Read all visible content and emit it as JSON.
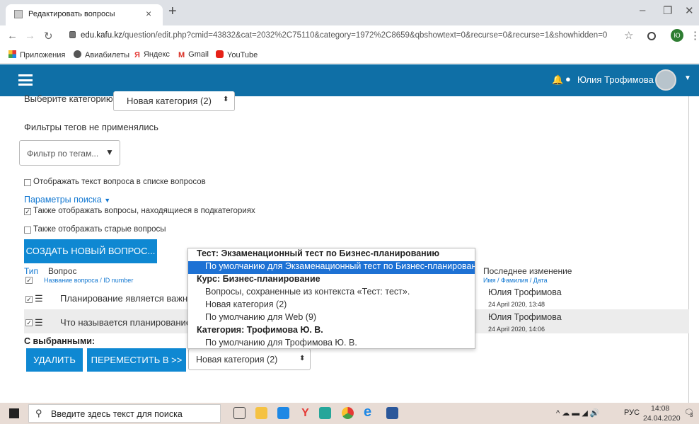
{
  "browser": {
    "tab_title": "Редактировать вопросы",
    "tab_close": "×",
    "new_tab": "+",
    "url_host": "edu.kafu.kz",
    "url_path": "/question/edit.php?cmid=43832&cat=2032%2C75110&category=1972%2C8659&qbshowtext=0&recurse=0&recurse=1&showhidden=0",
    "profile_initials": "Ю",
    "bookmarks": [
      "Приложения",
      "Авиабилеты",
      "Яндекс",
      "Gmail",
      "YouTube"
    ]
  },
  "header": {
    "user_name": "Юлия Трофимова"
  },
  "filters": {
    "category_label": "Выберите категорию:",
    "category_value": "Новая категория (2)",
    "tags_note": "Фильтры тегов не применялись",
    "tag_filter_placeholder": "Фильтр по тегам...",
    "show_question_text": "Отображать текст вопроса в списке вопросов",
    "search_params": "Параметры поиска",
    "include_subcategories": "Также отображать вопросы, находящиеся в подкатегориях",
    "show_old": "Также отображать старые вопросы"
  },
  "actions": {
    "create_question": "СОЗДАТЬ НОВЫЙ ВОПРОС...",
    "with_selected": "С выбранными:",
    "delete": "УДАЛИТЬ",
    "move_to": "ПЕРЕМЕСТИТЬ В >>",
    "move_target": "Новая категория (2)"
  },
  "table": {
    "col_type": "Тип",
    "col_question": "Вопрос",
    "sort_links": "Название вопроса / ID number",
    "col_modified": "Последнее изменение",
    "modified_sort": "Имя / Фамилия / Дата",
    "rows": [
      {
        "name": "Планирование является важнейш",
        "author": "Юлия Трофимова",
        "date": "24 April 2020, 13:48"
      },
      {
        "name": "Что называется планированием?",
        "author": "Юлия Трофимова",
        "date": "24 April 2020, 14:06"
      }
    ]
  },
  "dropdown": {
    "items": [
      {
        "text": "Тест: Экзаменационный тест по Бизнес-планированию",
        "kind": "group"
      },
      {
        "text": "По умолчанию для Экзаменационный тест по Бизнес-планированию",
        "kind": "selected"
      },
      {
        "text": "Курс: Бизнес-планирование",
        "kind": "group"
      },
      {
        "text": "Вопросы, сохраненные из контекста «Тест: тест».",
        "kind": "option"
      },
      {
        "text": "Новая категория (2)",
        "kind": "option"
      },
      {
        "text": "По умолчанию для Web (9)",
        "kind": "option"
      },
      {
        "text": "Категория: Трофимова Ю. В.",
        "kind": "group"
      },
      {
        "text": "По умолчанию для Трофимова Ю. В.",
        "kind": "option"
      }
    ]
  },
  "taskbar": {
    "search_placeholder": "Введите здесь текст для поиска",
    "lang": "РУС",
    "time": "14:08",
    "date": "24.04.2020",
    "notifications": "3"
  },
  "colors": {
    "header": "#0f6fa6",
    "button": "#0f88d2",
    "selected": "#1d71d4"
  }
}
